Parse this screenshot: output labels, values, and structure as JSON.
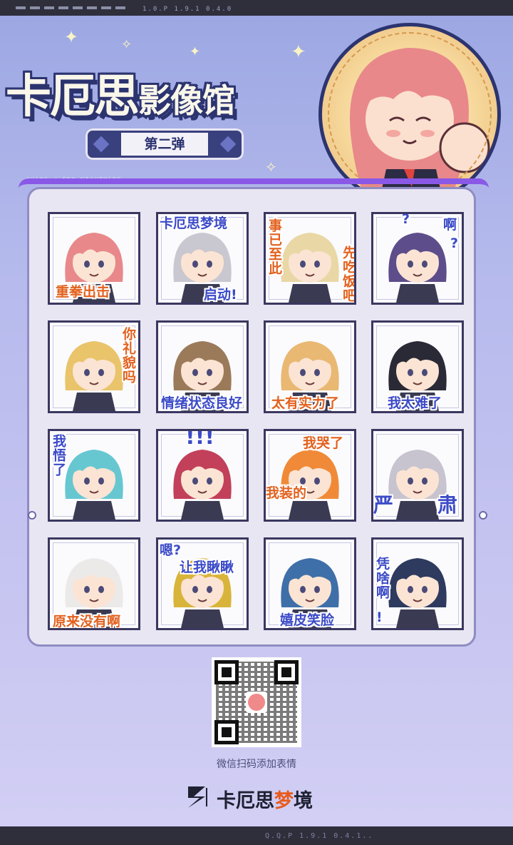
{
  "top_bar": {
    "code": "1.0.P 1.9.1 0.4.0"
  },
  "title": {
    "part1": "卡厄思",
    "part2": "影像馆"
  },
  "subtitle": "第二弹",
  "tag": "CHAOS / ERO NIGHTMARE",
  "stickers": [
    {
      "captions": [
        "重拳出击"
      ]
    },
    {
      "captions": [
        "卡厄思梦境",
        "启动!"
      ]
    },
    {
      "captions": [
        "事已至此",
        "先吃饭吧"
      ]
    },
    {
      "captions": [
        "啊",
        "?",
        "?"
      ]
    },
    {
      "captions": [
        "你礼貌吗"
      ]
    },
    {
      "captions": [
        "情绪状态良好"
      ]
    },
    {
      "captions": [
        "太有实力了"
      ]
    },
    {
      "captions": [
        "我太难了"
      ]
    },
    {
      "captions": [
        "我悟了"
      ]
    },
    {
      "captions": [
        "!!!"
      ]
    },
    {
      "captions": [
        "我哭了",
        "我装的"
      ]
    },
    {
      "captions": [
        "严",
        "肃"
      ]
    },
    {
      "captions": [
        "原来没有啊"
      ]
    },
    {
      "captions": [
        "嗯?",
        "让我瞅瞅"
      ]
    },
    {
      "captions": [
        "嬉皮笑脸"
      ]
    },
    {
      "captions": [
        "凭啥啊",
        "!"
      ]
    }
  ],
  "qr_caption": "微信扫码添加表情",
  "brand": {
    "part1": "卡厄思",
    "highlight": "梦",
    "part2": "境"
  },
  "bottom_bar": {
    "code": "Q.Q.P 1.9.1 0.4.1.."
  }
}
